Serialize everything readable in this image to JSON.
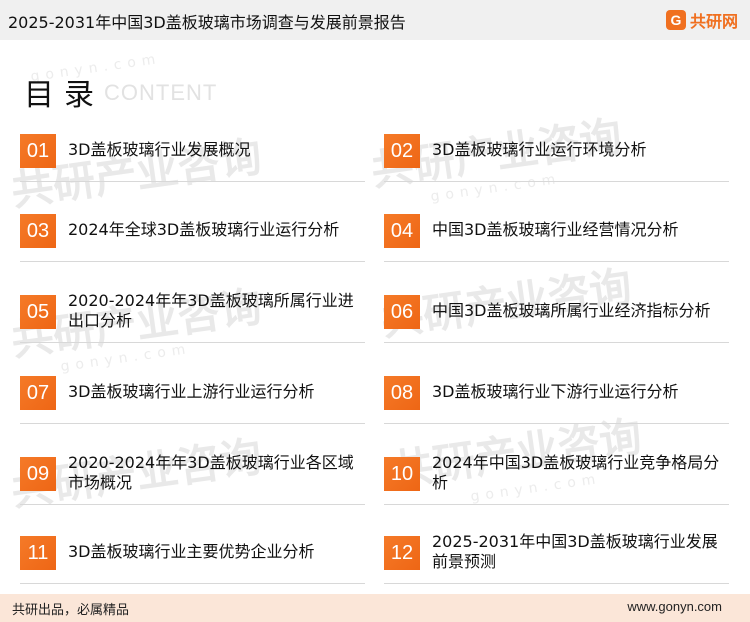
{
  "header": {
    "title": "2025-2031年中国3D盖板玻璃市场调查与发展前景报告",
    "logo_mark": "G",
    "logo_text": "共研网"
  },
  "watermark": {
    "text": "共研产业咨询",
    "domain": "gonyn.com"
  },
  "toc": {
    "heading": "目录",
    "heading_en": "CONTENT",
    "items": [
      {
        "num": "01",
        "label": "3D盖板玻璃行业发展概况"
      },
      {
        "num": "02",
        "label": "3D盖板玻璃行业运行环境分析"
      },
      {
        "num": "03",
        "label": "2024年全球3D盖板玻璃行业运行分析"
      },
      {
        "num": "04",
        "label": "中国3D盖板玻璃行业经营情况分析"
      },
      {
        "num": "05",
        "label": "2020-2024年年3D盖板玻璃所属行业进出口分析"
      },
      {
        "num": "06",
        "label": "中国3D盖板玻璃所属行业经济指标分析"
      },
      {
        "num": "07",
        "label": "3D盖板玻璃行业上游行业运行分析"
      },
      {
        "num": "08",
        "label": "3D盖板玻璃行业下游行业运行分析"
      },
      {
        "num": "09",
        "label": "2020-2024年年3D盖板玻璃行业各区域市场概况"
      },
      {
        "num": "10",
        "label": "2024年中国3D盖板玻璃行业竞争格局分析"
      },
      {
        "num": "11",
        "label": "3D盖板玻璃行业主要优势企业分析"
      },
      {
        "num": "12",
        "label": "2025-2031年中国3D盖板玻璃行业发展前景预测"
      }
    ]
  },
  "footer": {
    "slogan": "共研出品，必属精品",
    "website": "www.gonyn.com"
  }
}
